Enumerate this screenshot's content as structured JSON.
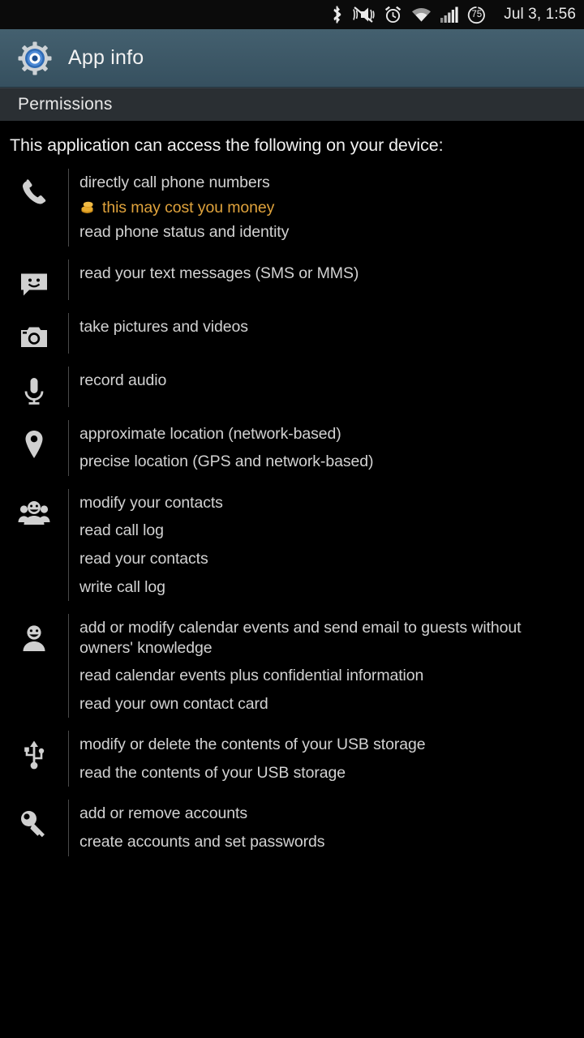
{
  "statusbar": {
    "icons": [
      "bluetooth-icon",
      "mute-vibrate-icon",
      "alarm-icon",
      "wifi-icon",
      "signal-icon"
    ],
    "battery_level": "75",
    "time": "Jul 3, 1:56"
  },
  "actionbar": {
    "icon": "settings-gear-icon",
    "title": "App info"
  },
  "subheader": {
    "title": "Permissions"
  },
  "content": {
    "intro": "This application can access the following on your device:",
    "colors": {
      "accent_bar": "#3d5867",
      "warning": "#e0a33c",
      "text": "#d2d2d2",
      "background": "#000000"
    },
    "groups": [
      {
        "icon": "phone-icon",
        "items": [
          {
            "text": "directly call phone numbers",
            "type": "normal"
          },
          {
            "text": "this may cost you money",
            "type": "cost",
            "icon": "coins-icon"
          },
          {
            "text": "read phone status and identity",
            "type": "normal"
          }
        ]
      },
      {
        "icon": "sms-message-icon",
        "items": [
          {
            "text": "read your text messages (SMS or MMS)",
            "type": "normal"
          }
        ]
      },
      {
        "icon": "camera-icon",
        "items": [
          {
            "text": "take pictures and videos",
            "type": "normal"
          }
        ]
      },
      {
        "icon": "microphone-icon",
        "items": [
          {
            "text": "record audio",
            "type": "normal"
          }
        ]
      },
      {
        "icon": "location-pin-icon",
        "items": [
          {
            "text": "approximate location (network-based)",
            "type": "normal"
          },
          {
            "text": "precise location (GPS and network-based)",
            "type": "normal"
          }
        ]
      },
      {
        "icon": "contacts-group-icon",
        "items": [
          {
            "text": "modify your contacts",
            "type": "normal"
          },
          {
            "text": "read call log",
            "type": "normal"
          },
          {
            "text": "read your contacts",
            "type": "normal"
          },
          {
            "text": "write call log",
            "type": "normal"
          }
        ]
      },
      {
        "icon": "person-icon",
        "items": [
          {
            "text": "add or modify calendar events and send email to guests without owners' knowledge",
            "type": "normal"
          },
          {
            "text": "read calendar events plus confidential information",
            "type": "normal"
          },
          {
            "text": "read your own contact card",
            "type": "normal"
          }
        ]
      },
      {
        "icon": "usb-icon",
        "items": [
          {
            "text": "modify or delete the contents of your USB storage",
            "type": "normal"
          },
          {
            "text": "read the contents of your USB storage",
            "type": "normal"
          }
        ]
      },
      {
        "icon": "key-icon",
        "items": [
          {
            "text": "add or remove accounts",
            "type": "normal"
          },
          {
            "text": "create accounts and set passwords",
            "type": "normal"
          }
        ]
      }
    ]
  }
}
